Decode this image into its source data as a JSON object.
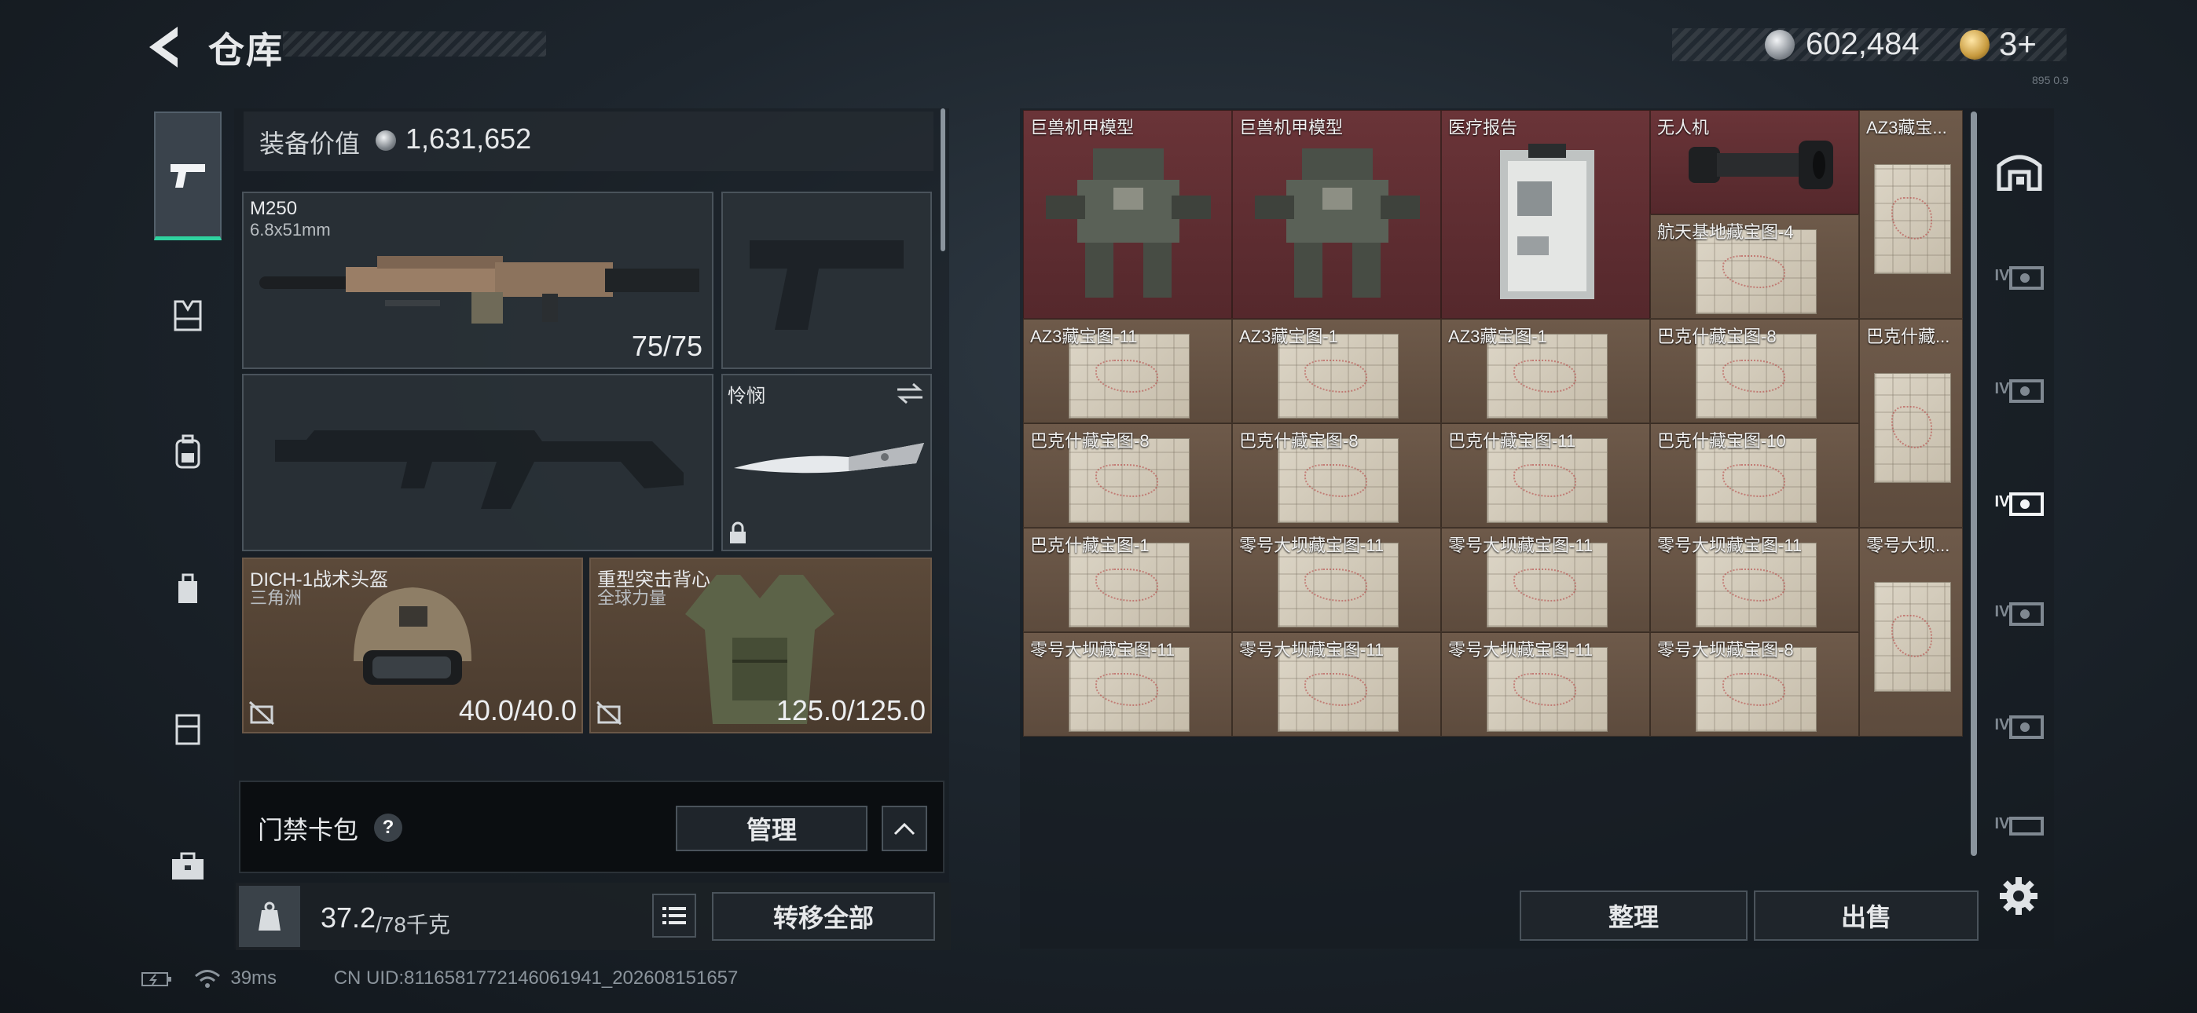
{
  "header": {
    "title": "仓库",
    "balance": "602,484",
    "tickets": "3+",
    "small_tag": "895 0.9"
  },
  "equipment": {
    "value_label": "装备价值",
    "value": "1,631,652"
  },
  "slots": {
    "primary": {
      "name": "M250",
      "caliber": "6.8x51mm",
      "ammo": "75/75"
    },
    "melee": {
      "name": "怜悯"
    },
    "helmet": {
      "name": "DICH-1战术头盔",
      "origin": "三角洲",
      "durability": "40.0/40.0"
    },
    "armor": {
      "name": "重型突击背心",
      "origin": "全球力量",
      "durability": "125.0/125.0"
    }
  },
  "card_pack": {
    "label": "门禁卡包",
    "help": "?",
    "manage": "管理"
  },
  "weight": {
    "value": "37.2",
    "max": "/78千克",
    "transfer": "转移全部"
  },
  "stash": {
    "items": [
      "巨兽机甲模型",
      "巨兽机甲模型",
      "医疗报告",
      "无人机",
      "AZ3藏宝...",
      "航天基地藏宝图-4",
      "AZ3藏宝图-11",
      "AZ3藏宝图-1",
      "AZ3藏宝图-1",
      "巴克什藏宝图-8",
      "巴克什藏...",
      "巴克什藏宝图-8",
      "巴克什藏宝图-8",
      "巴克什藏宝图-11",
      "巴克什藏宝图-10",
      "巴克什藏宝图-1",
      "零号大坝藏宝图-11",
      "零号大坝藏宝图-11",
      "零号大坝藏宝图-11",
      "零号大坝...",
      "零号大坝藏宝图-11",
      "零号大坝藏宝图-11",
      "零号大坝藏宝图-11",
      "零号大坝藏宝图-8"
    ],
    "sort": "整理",
    "sell": "出售"
  },
  "tabs": {
    "stash_level": "IV"
  },
  "status": {
    "ping": "39ms",
    "uid": "CN UID:8116581772146061941_202608151657"
  },
  "colors": {
    "accent": "#2fd3a0",
    "cell_brown": "#5d4b3d",
    "cell_red": "#55282c"
  }
}
